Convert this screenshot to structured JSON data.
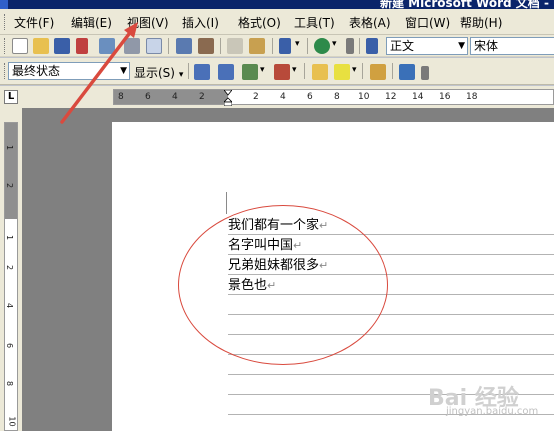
{
  "window": {
    "title": "新建 Microsoft Word 文档 - Microsoft Word"
  },
  "menu": {
    "items": [
      "文件(F)",
      "编辑(E)",
      "视图(V)",
      "插入(I)",
      "格式(O)",
      "工具(T)",
      "表格(A)",
      "窗口(W)",
      "帮助(H)"
    ]
  },
  "toolbar": {
    "style_value": "正文",
    "font_value": "宋体",
    "review_state": "最终状态",
    "show_label": "显示(S)",
    "show_arrow": "▾"
  },
  "ruler": {
    "corner": "L",
    "ticks": [
      "8",
      "6",
      "4",
      "2",
      "2",
      "4",
      "6",
      "8",
      "10",
      "12",
      "14",
      "16",
      "18"
    ],
    "vticks": [
      "1",
      "2",
      "1",
      "2",
      "4",
      "6",
      "8",
      "10"
    ]
  },
  "document": {
    "lines": [
      "我们都有一个家",
      "名字叫中国",
      "兄弟姐妹都很多",
      "景色也"
    ],
    "paragraph_mark": "↵"
  },
  "watermark": {
    "text": "Bai 经验",
    "sub": "jingyan.baidu.com"
  },
  "colors": {
    "annotation": "#d94a3e",
    "titlebar": "#0a246a"
  }
}
